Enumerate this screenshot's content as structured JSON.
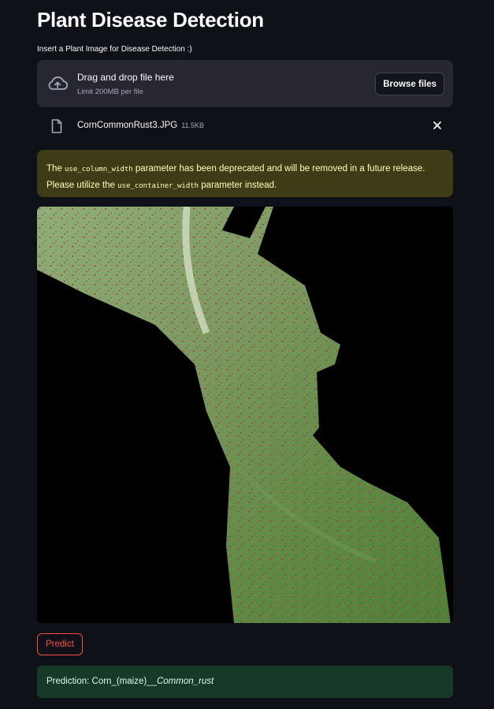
{
  "page": {
    "title": "Plant Disease Detection",
    "uploader_label": "Insert a Plant Image for Disease Detection :)"
  },
  "uploader": {
    "drop_text": "Drag and drop file here",
    "limit_text": "Limit 200MB per file",
    "browse_label": "Browse files",
    "icon": "cloud-upload-icon"
  },
  "uploaded_file": {
    "name": "CornCommonRust3.JPG",
    "size": "11.5KB",
    "icon": "file-icon",
    "remove_icon": "close-icon"
  },
  "warning": {
    "part1": "The ",
    "code1": "use_column_width",
    "part2": " parameter has been deprecated and will be removed in a future release. Please utilize the ",
    "code2": "use_container_width",
    "part3": " parameter instead."
  },
  "actions": {
    "predict_label": "Predict"
  },
  "result": {
    "prefix": "Prediction: Corn_(maize)__",
    "emphasis": "Common_rust"
  },
  "colors": {
    "background": "#0e1117",
    "accent": "#ff4b4b",
    "warning_bg": "#3e3b16",
    "success_bg": "#173928"
  }
}
